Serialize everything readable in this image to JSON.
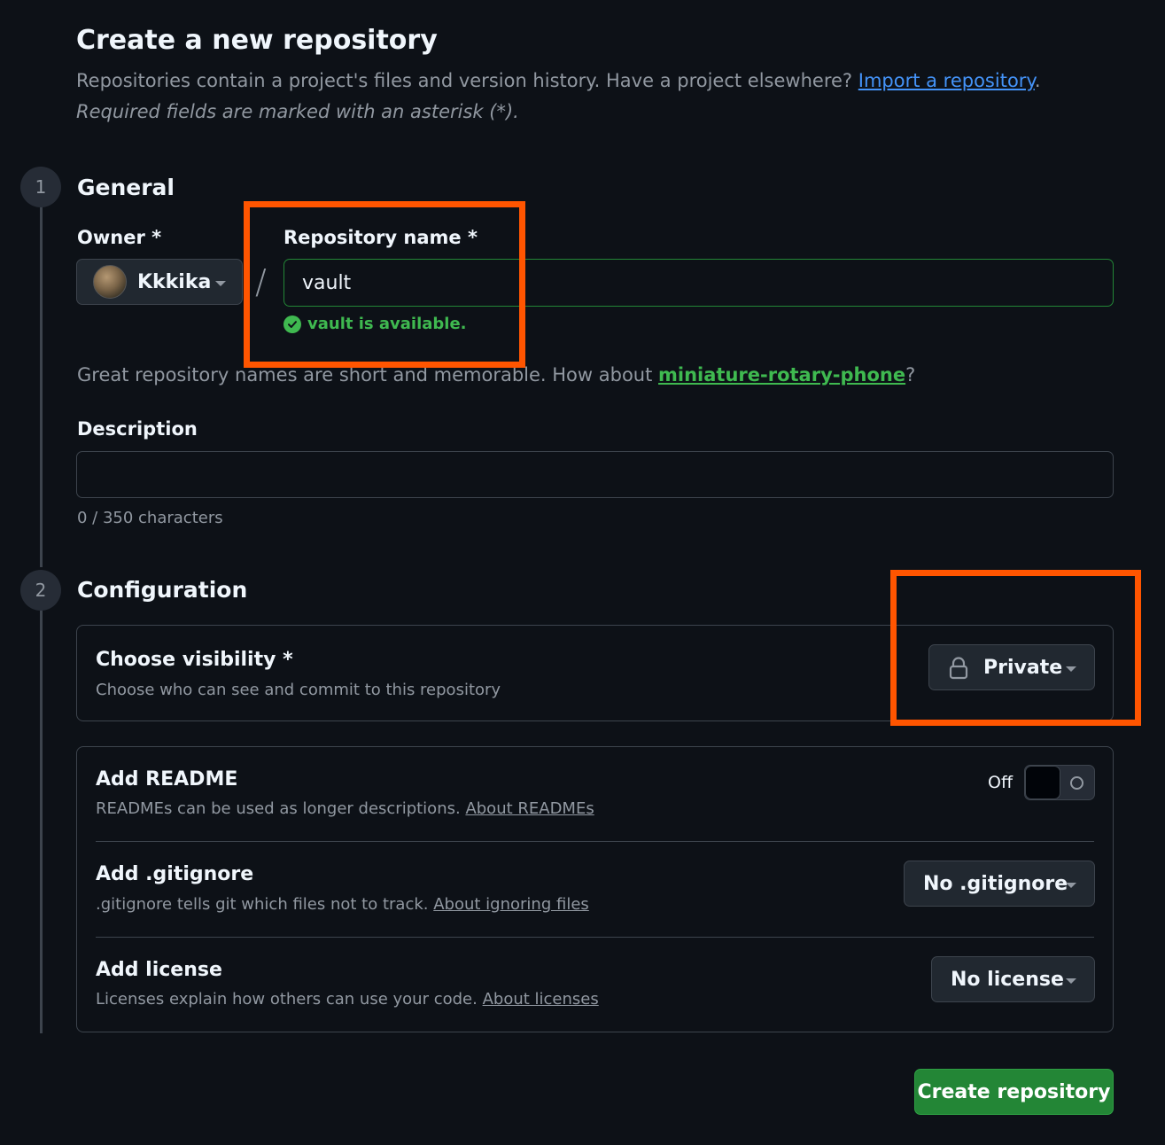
{
  "header": {
    "title": "Create a new repository",
    "subtitle_prefix": "Repositories contain a project's files and version history. Have a project elsewhere?",
    "import_link": "Import a repository",
    "subtitle_suffix": ".",
    "required_note": "Required fields are marked with an asterisk (*)."
  },
  "general": {
    "step": "1",
    "title": "General",
    "owner_label": "Owner *",
    "owner_name": "Kkkika",
    "separator": "/",
    "repo_name_label": "Repository name *",
    "repo_name_value": "vault",
    "availability": "vault is available.",
    "suggest_prefix": "Great repository names are short and memorable. How about",
    "suggest_name": "miniature-rotary-phone",
    "suggest_suffix": "?",
    "description_label": "Description",
    "description_value": "",
    "char_count": "0 / 350 characters"
  },
  "configuration": {
    "step": "2",
    "title": "Configuration",
    "visibility": {
      "title": "Choose visibility *",
      "desc": "Choose who can see and commit to this repository",
      "value": "Private",
      "icon": "lock-icon"
    },
    "readme": {
      "title": "Add README",
      "desc": "READMEs can be used as longer descriptions.",
      "link": "About READMEs",
      "toggle_state": "Off"
    },
    "gitignore": {
      "title": "Add .gitignore",
      "desc": ".gitignore tells git which files not to track.",
      "link": "About ignoring files",
      "value": "No .gitignore"
    },
    "license": {
      "title": "Add license",
      "desc": "Licenses explain how others can use your code.",
      "link": "About licenses",
      "value": "No license"
    }
  },
  "actions": {
    "create_label": "Create repository"
  },
  "colors": {
    "background": "#0d1117",
    "accent_green": "#238636",
    "link_blue": "#4493f8",
    "highlight": "#ff5500"
  }
}
